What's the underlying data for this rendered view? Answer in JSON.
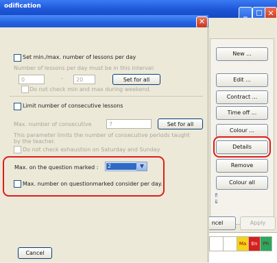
{
  "parent": {
    "title": "odification",
    "buttons": {
      "new": "New ...",
      "edit": "Edit ...",
      "contract": "Contract ...",
      "time_off": "Time off ...",
      "colour": "Colour ...",
      "details": "Details",
      "remove": "Remove",
      "colour_all": "Colour all",
      "cancel": "ncel",
      "apply": "Apply"
    },
    "grid_cells": [
      "Ma",
      "En",
      "Ph"
    ],
    "colors": {
      "ma": "#f4d31a",
      "en": "#d62020",
      "ph": "#28a860"
    }
  },
  "dialog": {
    "close_glyph": "✕",
    "lessons": {
      "checkbox_label": "Set min./max. number of lessons per day",
      "interval_note": "Number of lessons per day must be in this interval:",
      "min_value": "0",
      "dash": "-",
      "max_value": "20",
      "set_all": "Set for all",
      "weekend_label": "Do not check min and max during weekend."
    },
    "consecutive": {
      "checkbox_label": "Limit number of consecutive lessons",
      "max_label": "Max. number of consecutive",
      "value": "7",
      "set_all": "Set for all",
      "note": "This parameter limits the number of consecutive periods taught by the teacher.",
      "exhaustion_label": "Do not check exhaustion on Saturday and Sunday"
    },
    "question": {
      "label": "Max. on the question marked :",
      "select_value": "2",
      "per_day_label": "Max. number on questionmarked consider per day."
    },
    "cancel": "Cancel"
  },
  "highlight_color": "#e01a1a"
}
